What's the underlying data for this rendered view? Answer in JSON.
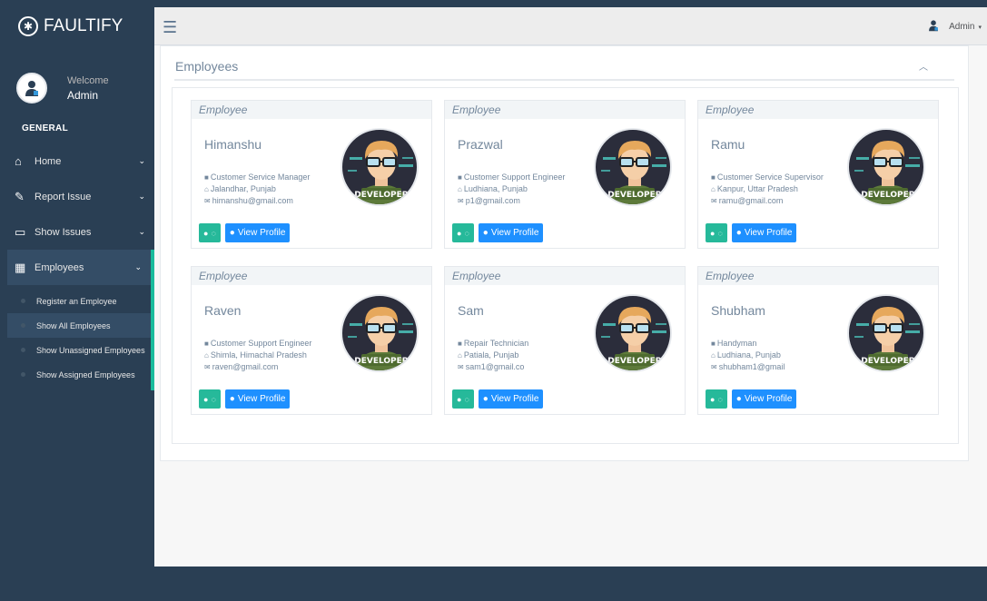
{
  "brand": {
    "name": "FAULTIFY",
    "logo_icon": "bug-icon"
  },
  "profile": {
    "welcome": "Welcome",
    "name": "Admin"
  },
  "sidebar": {
    "section": "GENERAL",
    "items": [
      {
        "label": "Home",
        "icon": "home-icon"
      },
      {
        "label": "Report Issue",
        "icon": "edit-icon"
      },
      {
        "label": "Show Issues",
        "icon": "desktop-icon"
      },
      {
        "label": "Employees",
        "icon": "table-icon"
      }
    ],
    "sub_items": [
      {
        "label": "Register an Employee"
      },
      {
        "label": "Show All Employees"
      },
      {
        "label": "Show Unassigned Employees"
      },
      {
        "label": "Show Assigned Employees"
      }
    ]
  },
  "topbar": {
    "user": "Admin"
  },
  "panel": {
    "title": "Employees"
  },
  "cards": [
    {
      "header": "Employee",
      "name": "Himanshu",
      "role": "Customer Service Manager",
      "location": "Jalandhar, Punjab",
      "email": "himanshu@gmail.com",
      "contact_label": "",
      "view_label": "View Profile",
      "badge": "DEVELOPER"
    },
    {
      "header": "Employee",
      "name": "Prazwal",
      "role": "Customer Support Engineer",
      "location": "Ludhiana, Punjab",
      "email": "p1@gmail.com",
      "contact_label": "",
      "view_label": "View Profile",
      "badge": "DEVELOPER"
    },
    {
      "header": "Employee",
      "name": "Ramu",
      "role": "Customer Service Supervisor",
      "location": "Kanpur, Uttar Pradesh",
      "email": "ramu@gmail.com",
      "contact_label": "",
      "view_label": "View Profile",
      "badge": "DEVELOPER"
    },
    {
      "header": "Employee",
      "name": "Raven",
      "role": "Customer Support Engineer",
      "location": "Shimla, Himachal Pradesh",
      "email": "raven@gmail.com",
      "contact_label": "",
      "view_label": "View Profile",
      "badge": "DEVELOPER"
    },
    {
      "header": "Employee",
      "name": "Sam",
      "role": "Repair Technician",
      "location": "Patiala, Punjab",
      "email": "sam1@gmail.co",
      "contact_label": "",
      "view_label": "View Profile",
      "badge": "DEVELOPER"
    },
    {
      "header": "Employee",
      "name": "Shubham",
      "role": "Handyman",
      "location": "Ludhiana, Punjab",
      "email": "shubham1@gmail",
      "contact_label": "",
      "view_label": "View Profile",
      "badge": "DEVELOPER"
    }
  ],
  "colors": {
    "sidebar": "#2a3f54",
    "accent": "#1abb9c",
    "btn_green": "#26b99a",
    "btn_blue": "#1e90ff"
  }
}
